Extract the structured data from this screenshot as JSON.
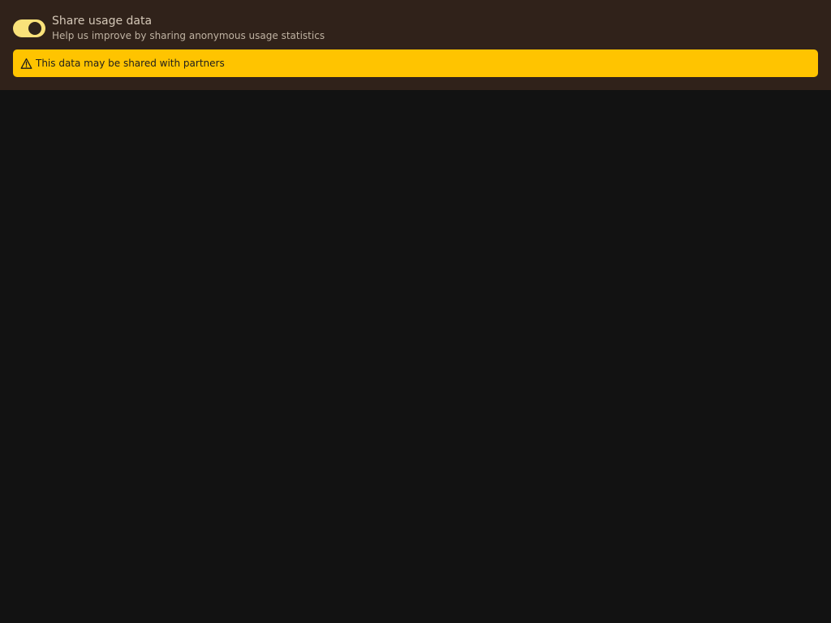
{
  "settings": {
    "share_usage": {
      "title": "Share usage data",
      "description": "Help us improve by sharing anonymous usage statistics",
      "enabled": true
    },
    "warning": {
      "icon": "warning-triangle-icon",
      "text": "This data may be shared with partners"
    }
  },
  "colors": {
    "panel_background": "#30221a",
    "page_background": "#121212",
    "toggle_on": "#f9e27a",
    "warning_background": "#ffc400",
    "warning_text": "#1d1d1d"
  }
}
